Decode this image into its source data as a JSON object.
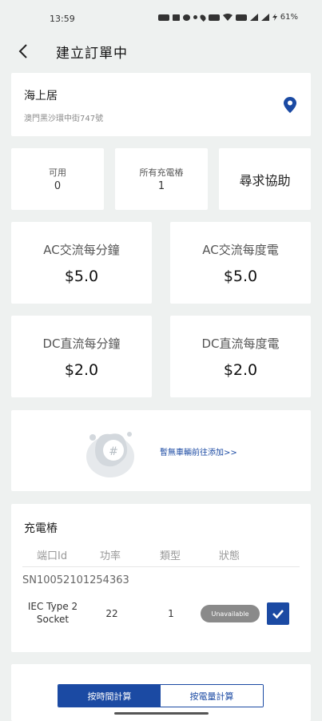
{
  "status_bar": {
    "time": "13:59",
    "battery": "61%",
    "icons": [
      "vpn-icon",
      "photo-icon",
      "alarm-icon",
      "dot-icon",
      "location-icon",
      "data-speed-icon",
      "wifi-icon",
      "hd-icon",
      "signal-icon",
      "signal-icon",
      "charging-icon"
    ]
  },
  "header": {
    "title": "建立訂單中"
  },
  "location": {
    "name": "海上居",
    "address": "澳門黑沙環中街747號"
  },
  "stats": [
    {
      "label": "可用",
      "value": "0"
    },
    {
      "label": "所有充電樁",
      "value": "1"
    }
  ],
  "help": {
    "label": "尋求協助"
  },
  "prices": [
    {
      "label": "AC交流每分鐘",
      "value": "$5.0"
    },
    {
      "label": "AC交流每度電",
      "value": "$5.0"
    },
    {
      "label": "DC直流每分鐘",
      "value": "$2.0"
    },
    {
      "label": "DC直流每度電",
      "value": "$2.0"
    }
  ],
  "vehicle": {
    "link_text": "暫無車輛前往添加>>"
  },
  "chargers": {
    "title": "充電樁",
    "columns": [
      "端口Id",
      "功率",
      "類型",
      "狀態"
    ],
    "serial": "SN10052101254363",
    "rows": [
      {
        "port": "IEC Type 2 Socket",
        "power": "22",
        "type": "1",
        "status": "Unavailable",
        "selected": true
      }
    ]
  },
  "billing": {
    "options": [
      "按時間計算",
      "按電量計算"
    ],
    "selected": "按時間計算"
  },
  "colors": {
    "primary": "#1b4aa3",
    "background": "#eef1f0",
    "card": "#ffffff",
    "status_pill": "#8a8a8a"
  }
}
